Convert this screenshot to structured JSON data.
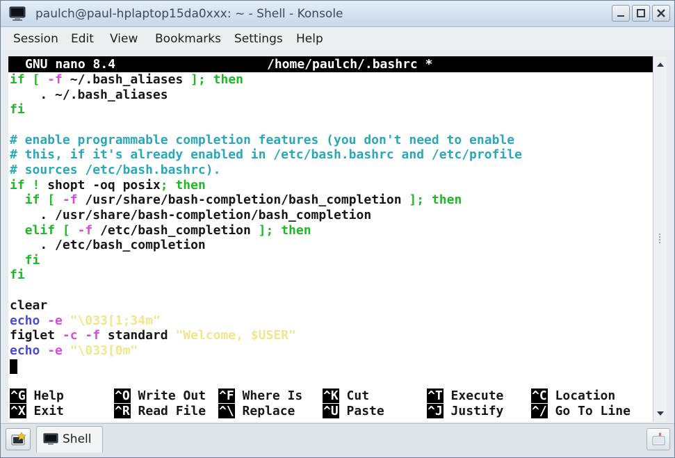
{
  "window": {
    "title": "paulch@paul-hplaptop15da0xxx: ~ - Shell - Konsole"
  },
  "menu": [
    "Session",
    "Edit",
    "View",
    "Bookmarks",
    "Settings",
    "Help"
  ],
  "nano": {
    "version": "GNU nano 8.4",
    "file": "/home/paulch/.bashrc *"
  },
  "code": {
    "l1": {
      "kw": "if",
      "br1": " [ ",
      "opt": "-f",
      "arg": " ~/.bash_aliases ",
      "br2": "];",
      "sp": " ",
      "kw2": "then"
    },
    "l2": "    . ~/.bash_aliases",
    "l3": "fi",
    "l5": "# enable programmable completion features (you don't need to enable",
    "l6": "# this, if it's already enabled in /etc/bash.bashrc and /etc/profile",
    "l7": "# sources /etc/bash.bashrc).",
    "l8": {
      "kw": "if",
      "bang": " ! ",
      "cmd": "shopt -oq posix",
      "semi": ";",
      "sp": " ",
      "kw2": "then"
    },
    "l9": {
      "indent": "  ",
      "kw": "if",
      "br1": " [ ",
      "opt": "-f",
      "arg": " /usr/share/bash-completion/bash_completion ",
      "br2": "];",
      "sp": " ",
      "kw2": "then"
    },
    "l10": "    . /usr/share/bash-completion/bash_completion",
    "l11": {
      "indent": "  ",
      "kw": "elif",
      "br1": " [ ",
      "opt": "-f",
      "arg": " /etc/bash_completion ",
      "br2": "];",
      "sp": " ",
      "kw2": "then"
    },
    "l12": "    . /etc/bash_completion",
    "l13": "  fi",
    "l14": "fi",
    "l16": "clear",
    "l17": {
      "cmd": "echo",
      "opt": " -e ",
      "str": "\"\\033[1;34m\""
    },
    "l18": {
      "cmd": "figlet",
      "opt1": " -c",
      "opt2": " -f",
      "arg": " standard ",
      "str": "\"Welcome, $USER\""
    },
    "l19": {
      "cmd": "echo",
      "opt": " -e ",
      "str": "\"\\033[0m\""
    }
  },
  "shortcuts": [
    {
      "key": "^G",
      "label": "Help"
    },
    {
      "key": "^X",
      "label": "Exit"
    },
    {
      "key": "^O",
      "label": "Write Out"
    },
    {
      "key": "^R",
      "label": "Read File"
    },
    {
      "key": "^F",
      "label": "Where Is"
    },
    {
      "key": "^\\",
      "label": "Replace"
    },
    {
      "key": "^K",
      "label": "Cut"
    },
    {
      "key": "^U",
      "label": "Paste"
    },
    {
      "key": "^T",
      "label": "Execute"
    },
    {
      "key": "^J",
      "label": "Justify"
    },
    {
      "key": "^C",
      "label": "Location"
    },
    {
      "key": "^/",
      "label": "Go To Line"
    }
  ],
  "tabs": [
    {
      "label": "Shell",
      "icon": "terminal-icon"
    }
  ],
  "icons": {
    "new_tab": "new-tab-icon",
    "close_tab": "close-tab-icon",
    "app": "konsole-icon"
  }
}
